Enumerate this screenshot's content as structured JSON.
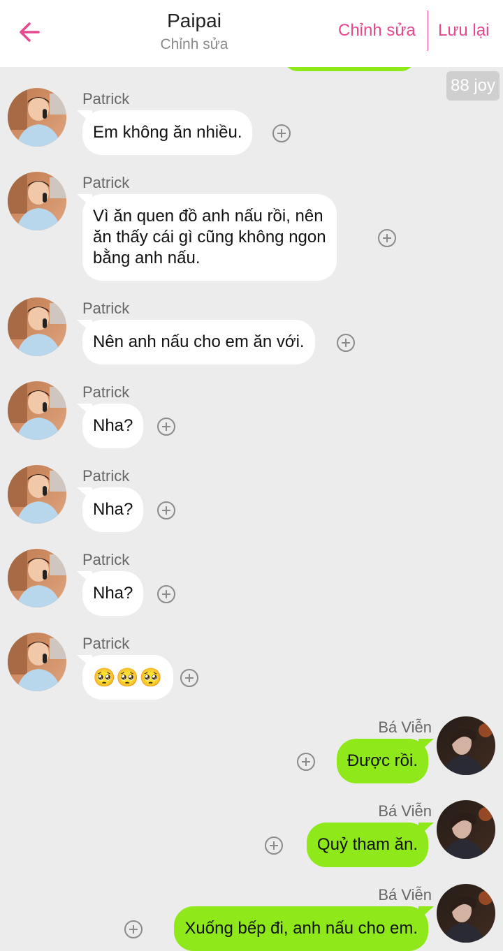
{
  "header": {
    "title": "Paipai",
    "subtitle": "Chỉnh sửa",
    "edit_label": "Chỉnh sửa",
    "save_label": "Lưu lại"
  },
  "badge": "88 joy",
  "messages": [
    {
      "sender": "Patrick",
      "text": "Em không ăn nhiều.",
      "side": "left"
    },
    {
      "sender": "Patrick",
      "lines": [
        "Vì ăn quen đồ anh nấu rồi, nên",
        "ăn thấy cái gì cũng không ngon",
        "bằng anh nấu."
      ],
      "side": "left"
    },
    {
      "sender": "Patrick",
      "text": "Nên anh nấu cho em ăn với.",
      "side": "left"
    },
    {
      "sender": "Patrick",
      "text": "Nha?",
      "side": "left"
    },
    {
      "sender": "Patrick",
      "text": "Nha?",
      "side": "left"
    },
    {
      "sender": "Patrick",
      "text": "Nha?",
      "side": "left"
    },
    {
      "sender": "Patrick",
      "text": "🥺🥺🥺",
      "side": "left"
    },
    {
      "sender": "Bá Viễn",
      "text": "Được rồi.",
      "side": "right"
    },
    {
      "sender": "Bá Viễn",
      "text": "Quỷ tham ăn.",
      "side": "right"
    },
    {
      "sender": "Bá Viễn",
      "text": "Xuống bếp đi, anh nấu cho em.",
      "side": "right"
    }
  ],
  "colors": {
    "accent": "#e5488f",
    "outgoing_bubble": "#8ee81a",
    "incoming_bubble": "#ffffff",
    "background": "#ececec"
  },
  "icons": {
    "back": "arrow-left-icon",
    "add": "plus-circle-icon"
  }
}
